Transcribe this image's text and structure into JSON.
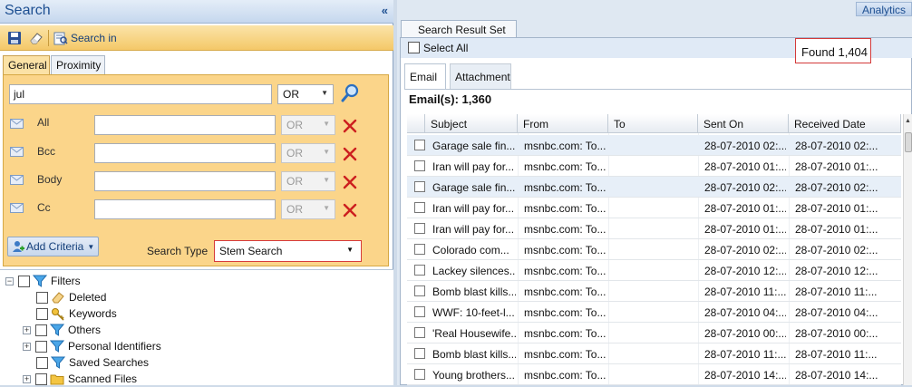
{
  "left_pane": {
    "title": "Search",
    "collapse_glyph": "«",
    "toolbar": {
      "save_icon": "save-icon",
      "clear_icon": "eraser-icon",
      "search_in_label": "Search in"
    },
    "tabs": [
      "General",
      "Proximity"
    ],
    "active_tab": "General",
    "query": {
      "value": "jul",
      "operator": "OR"
    },
    "criteria": [
      {
        "label": "All",
        "value": "",
        "operator": "OR"
      },
      {
        "label": "Bcc",
        "value": "",
        "operator": "OR"
      },
      {
        "label": "Body",
        "value": "",
        "operator": "OR"
      },
      {
        "label": "Cc",
        "value": "",
        "operator": "OR"
      }
    ],
    "add_criteria_label": "Add Criteria",
    "search_type_label": "Search Type",
    "search_type_value": "Stem Search",
    "filters_tree": {
      "root": "Filters",
      "items": [
        {
          "label": "Deleted",
          "icon": "eraser-icon",
          "expandable": false
        },
        {
          "label": "Keywords",
          "icon": "key-icon",
          "expandable": false
        },
        {
          "label": "Others",
          "icon": "funnel-icon",
          "expandable": true
        },
        {
          "label": "Personal Identifiers",
          "icon": "funnel-icon",
          "expandable": true
        },
        {
          "label": "Saved Searches",
          "icon": "funnel-icon",
          "expandable": false
        },
        {
          "label": "Scanned Files",
          "icon": "folder-icon",
          "expandable": true
        }
      ]
    }
  },
  "right_pane": {
    "analytics_label": "Analytics",
    "result_tab_label": "Search Result Set",
    "select_all_label": "Select All",
    "found_text": "Found 1,404",
    "subtabs": [
      "Email",
      "Attachment"
    ],
    "active_subtab": "Email",
    "emails_count_text": "Email(s):  1,360",
    "columns": [
      "Subject",
      "From",
      "To",
      "Sent On",
      "Received Date"
    ],
    "rows": [
      {
        "subject": "Garage sale fin...",
        "from": "msnbc.com: To...",
        "to": "",
        "sent": "28-07-2010 02:...",
        "received": "28-07-2010 02:...",
        "selected": true
      },
      {
        "subject": "Iran will pay for...",
        "from": "msnbc.com: To...",
        "to": "",
        "sent": "28-07-2010 01:...",
        "received": "28-07-2010 01:...",
        "selected": false
      },
      {
        "subject": "Garage sale fin...",
        "from": "msnbc.com: To...",
        "to": "",
        "sent": "28-07-2010 02:...",
        "received": "28-07-2010 02:...",
        "selected": true
      },
      {
        "subject": "Iran will pay for...",
        "from": "msnbc.com: To...",
        "to": "",
        "sent": "28-07-2010 01:...",
        "received": "28-07-2010 01:...",
        "selected": false
      },
      {
        "subject": "Iran will pay for...",
        "from": "msnbc.com: To...",
        "to": "",
        "sent": "28-07-2010 01:...",
        "received": "28-07-2010 01:...",
        "selected": false
      },
      {
        "subject": "Colorado com...",
        "from": "msnbc.com: To...",
        "to": "",
        "sent": "28-07-2010 02:...",
        "received": "28-07-2010 02:...",
        "selected": false
      },
      {
        "subject": "Lackey silences...",
        "from": "msnbc.com: To...",
        "to": "",
        "sent": "28-07-2010 12:...",
        "received": "28-07-2010 12:...",
        "selected": false
      },
      {
        "subject": "Bomb blast kills...",
        "from": "msnbc.com: To...",
        "to": "",
        "sent": "28-07-2010 11:...",
        "received": "28-07-2010 11:...",
        "selected": false
      },
      {
        "subject": "WWF: 10-feet-l...",
        "from": "msnbc.com: To...",
        "to": "",
        "sent": "28-07-2010 04:...",
        "received": "28-07-2010 04:...",
        "selected": false
      },
      {
        "subject": "'Real Housewife...",
        "from": "msnbc.com: To...",
        "to": "",
        "sent": "28-07-2010 00:...",
        "received": "28-07-2010 00:...",
        "selected": false
      },
      {
        "subject": "Bomb blast kills...",
        "from": "msnbc.com: To...",
        "to": "",
        "sent": "28-07-2010 11:...",
        "received": "28-07-2010 11:...",
        "selected": false
      },
      {
        "subject": "Young brothers...",
        "from": "msnbc.com: To...",
        "to": "",
        "sent": "28-07-2010 14:...",
        "received": "28-07-2010 14:...",
        "selected": false
      }
    ]
  },
  "colors": {
    "criteria_panel": "#fbd58a",
    "title_text": "#1d4f91",
    "highlight_border": "#d33a3a",
    "delete_x": "#cc1f1f"
  }
}
